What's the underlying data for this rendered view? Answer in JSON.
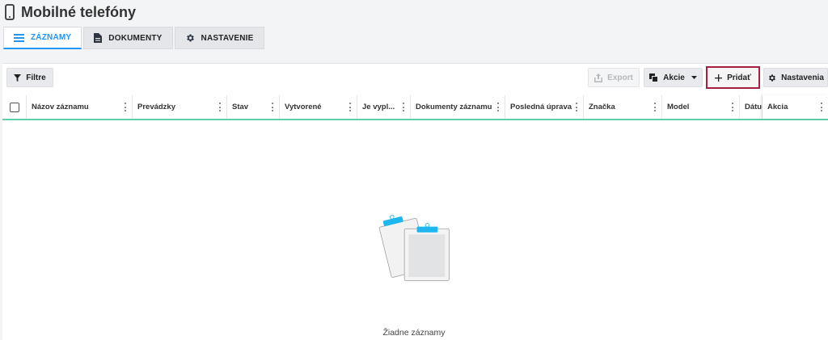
{
  "page": {
    "title": "Mobilné telefóny"
  },
  "tabs": [
    {
      "label": "ZÁZNAMY",
      "icon": "list-icon",
      "active": true
    },
    {
      "label": "DOKUMENTY",
      "icon": "document-icon",
      "active": false
    },
    {
      "label": "NASTAVENIE",
      "icon": "gear-icon",
      "active": false
    }
  ],
  "toolbar": {
    "filter_label": "Filtre",
    "export_label": "Export",
    "actions_label": "Akcie",
    "add_label": "Pridať",
    "settings_label": "Nastavenia"
  },
  "table": {
    "columns": [
      "Názov záznamu",
      "Prevádzky",
      "Stav",
      "Vytvorené",
      "Je vypl...",
      "Dokumenty záznamu",
      "Posledná úprava",
      "Značka",
      "Model",
      "Dátu",
      "Akcia"
    ]
  },
  "empty_state": {
    "text": "Žiadne záznamy"
  },
  "colors": {
    "accent": "#2196f3",
    "header_underline": "#5fd0a8",
    "highlight_border": "#a3213f",
    "clipboard_clip": "#1fb6f0"
  }
}
